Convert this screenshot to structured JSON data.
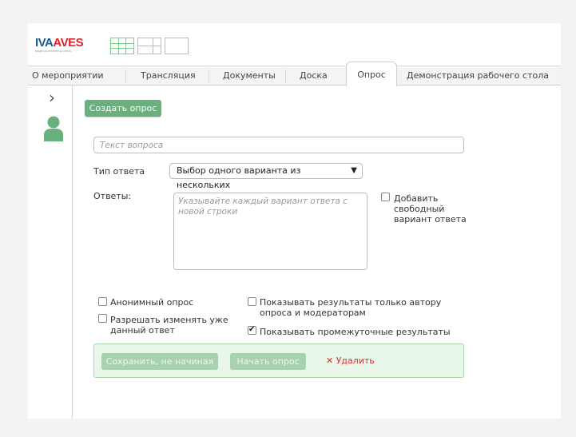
{
  "logo": {
    "part1": "IVA",
    "part2": "AVES",
    "sub": "ВИДЕОКОНФЕРЕНЦ-СВЯЗЬ"
  },
  "tabs": [
    "О мероприятии",
    "Трансляция",
    "Документы",
    "Доска",
    "Опрос",
    "Демонстрация рабочего стола"
  ],
  "active_tab": "Опрос",
  "create_button": "Создать опрос",
  "question": {
    "placeholder": "Текст вопроса"
  },
  "answer_type": {
    "label": "Тип ответа",
    "value": "Выбор одного варианта из нескольких"
  },
  "answers": {
    "label": "Ответы:",
    "placeholder": "Указывайте каждый вариант ответа с новой строки"
  },
  "free_answer": {
    "text": "Добавить свободный вариант ответа",
    "checked": false
  },
  "options": {
    "anonymous": "Анонимный опрос",
    "allow_change": "Разрешать изменять уже данный ответ",
    "results_author": "Показывать результаты только автору опроса и модераторам",
    "intermediate": "Показывать промежуточные результаты"
  },
  "footer": {
    "save": "Сохранить, не начиная",
    "start": "Начать опрос",
    "delete": "Удалить"
  },
  "colors": {
    "accent": "#6ab07c",
    "delete": "#d9302c"
  }
}
